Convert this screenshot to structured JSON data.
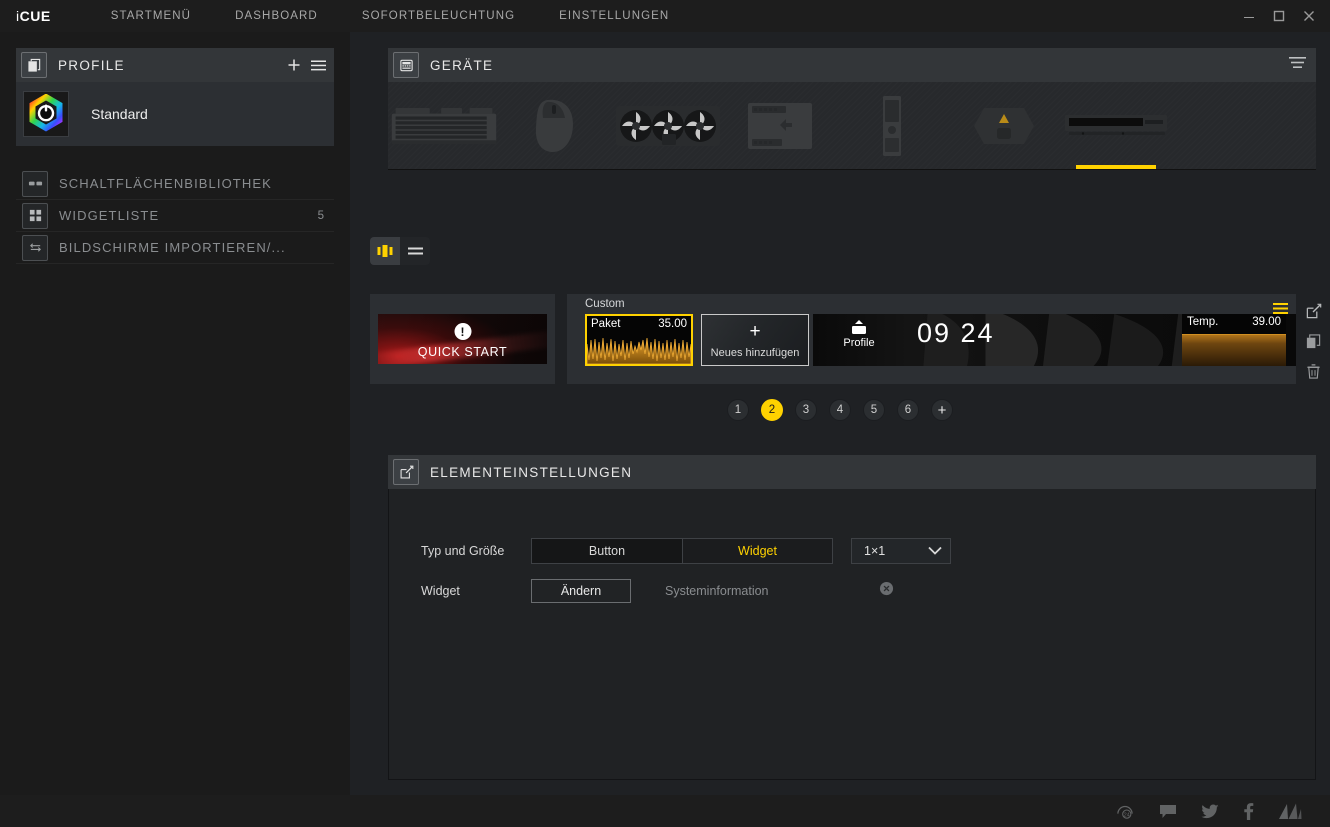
{
  "titlebar": {
    "brand_i": "i",
    "brand_cue": "CUE",
    "menu": [
      {
        "label": "STARTMENÜ"
      },
      {
        "label": "DASHBOARD"
      },
      {
        "label": "SOFORTBELEUCHTUNG"
      },
      {
        "label": "EINSTELLUNGEN"
      }
    ],
    "window_controls": [
      {
        "name": "minimize-button",
        "icon": "minimize-icon"
      },
      {
        "name": "maximize-button",
        "icon": "maximize-icon"
      },
      {
        "name": "close-button",
        "icon": "close-icon"
      }
    ]
  },
  "sidebar": {
    "header": {
      "title": "PROFILE",
      "icon": "profiles-icon",
      "add_icon": "plus-icon",
      "menu_icon": "hamburger-icon"
    },
    "profiles": [
      {
        "name": "Standard",
        "icon": "icue-logo-icon"
      }
    ],
    "nav": [
      {
        "label": "SCHALTFLÄCHENBIBLIOTHEK",
        "icon": "button-library-icon",
        "count": ""
      },
      {
        "label": "WIDGETLISTE",
        "icon": "widget-grid-icon",
        "count": "5"
      },
      {
        "label": "BILDSCHIRME IMPORTIEREN/...",
        "icon": "import-export-icon",
        "count": ""
      }
    ]
  },
  "devices": {
    "header": {
      "title": "GERÄTE",
      "icon": "keyboard-icon",
      "sort_icon": "sort-icon"
    },
    "items": [
      {
        "name": "keyboard",
        "selected": false
      },
      {
        "name": "mouse",
        "selected": false
      },
      {
        "name": "aio-cooler",
        "selected": false
      },
      {
        "name": "commander-controller",
        "selected": false
      },
      {
        "name": "memory-module",
        "selected": false
      },
      {
        "name": "headset-stand",
        "selected": false
      },
      {
        "name": "lcd-display-bar",
        "selected": true
      }
    ]
  },
  "view_toggle": [
    {
      "name": "grid-view-button",
      "icon": "grid-view-icon",
      "active": true
    },
    {
      "name": "list-view-button",
      "icon": "list-view-icon",
      "active": false
    }
  ],
  "board": {
    "quick_start": {
      "label": "QUICK START",
      "icon": "exclamation-icon"
    },
    "group_label": "Custom",
    "menu_icon": "hamburger-icon",
    "widgets": {
      "paket": {
        "name": "Paket",
        "value": "35.00",
        "selected": true
      },
      "add": {
        "label": "Neues hinzufügen",
        "icon": "plus-icon"
      },
      "profile": {
        "label": "Profile",
        "icon": "profile-save-icon"
      },
      "clock": {
        "value": "09 24"
      },
      "temp": {
        "name": "Temp.",
        "value": "39.00"
      }
    },
    "actions": [
      {
        "name": "edit-button",
        "icon": "edit-icon"
      },
      {
        "name": "duplicate-button",
        "icon": "copy-icon"
      },
      {
        "name": "delete-button",
        "icon": "trash-icon"
      }
    ]
  },
  "pager": {
    "pages": [
      {
        "label": "1",
        "active": false
      },
      {
        "label": "2",
        "active": true
      },
      {
        "label": "3",
        "active": false
      },
      {
        "label": "4",
        "active": false
      },
      {
        "label": "5",
        "active": false
      },
      {
        "label": "6",
        "active": false
      }
    ],
    "add_label": "+"
  },
  "element_settings": {
    "header": {
      "title": "ELEMENTEINSTELLUNGEN",
      "icon": "edit-icon"
    },
    "type_size": {
      "label": "Typ und Größe",
      "options": [
        {
          "label": "Button",
          "active": false
        },
        {
          "label": "Widget",
          "active": true
        }
      ],
      "size_value": "1×1",
      "size_chevron_icon": "chevron-down-icon"
    },
    "widget": {
      "label": "Widget",
      "change_button": "Ändern",
      "value": "Systeminformation",
      "clear_icon": "clear-circle-icon"
    }
  },
  "bottombar": {
    "social": [
      {
        "name": "support-24-icon"
      },
      {
        "name": "chat-bubble-icon"
      },
      {
        "name": "twitter-icon"
      },
      {
        "name": "facebook-icon"
      },
      {
        "name": "corsair-sails-icon"
      }
    ]
  },
  "colors": {
    "accent_yellow": "#ffd200",
    "panel_header": "#333639",
    "app_bg": "#1f2124",
    "sidebar_bg": "#1b1b1b"
  }
}
